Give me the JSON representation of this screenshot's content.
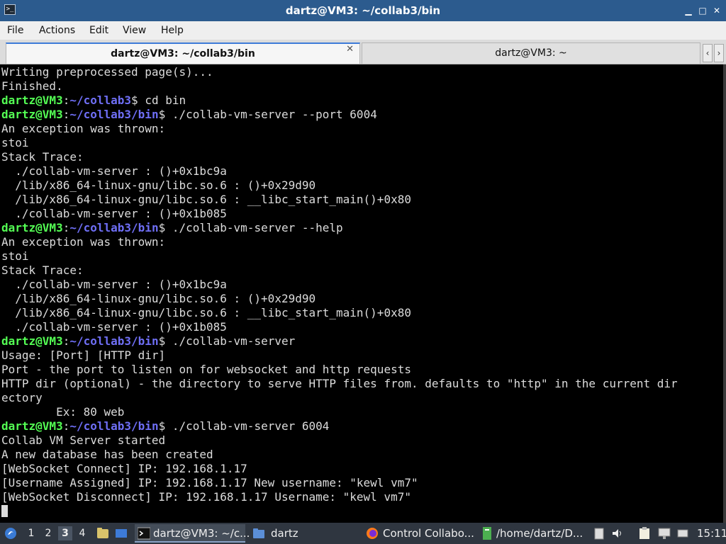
{
  "window": {
    "title": "dartz@VM3: ~/collab3/bin",
    "app_icon_glyph": ">_",
    "minimize_glyph": "▁",
    "maximize_glyph": "□",
    "close_glyph": "✕"
  },
  "menu": [
    "File",
    "Actions",
    "Edit",
    "View",
    "Help"
  ],
  "tabs": [
    {
      "label": "dartz@VM3: ~/collab3/bin",
      "active": true,
      "close_glyph": "✕"
    },
    {
      "label": "dartz@VM3: ~",
      "active": false
    }
  ],
  "tab_nav": {
    "prev": "‹",
    "next": "›"
  },
  "terminal": {
    "lines": [
      {
        "text": "Writing preprocessed page(s)..."
      },
      {
        "text": "Finished."
      },
      {
        "prompt_user": "dartz@VM3",
        "prompt_sep": ":",
        "prompt_dir": "~/collab3",
        "prompt_end": "$ ",
        "cmd": "cd bin"
      },
      {
        "prompt_user": "dartz@VM3",
        "prompt_sep": ":",
        "prompt_dir": "~/collab3/bin",
        "prompt_end": "$ ",
        "cmd": "./collab-vm-server --port 6004"
      },
      {
        "text": "An exception was thrown:"
      },
      {
        "text": "stoi"
      },
      {
        "text": "Stack Trace:"
      },
      {
        "text": "  ./collab-vm-server : ()+0x1bc9a"
      },
      {
        "text": "  /lib/x86_64-linux-gnu/libc.so.6 : ()+0x29d90"
      },
      {
        "text": "  /lib/x86_64-linux-gnu/libc.so.6 : __libc_start_main()+0x80"
      },
      {
        "text": "  ./collab-vm-server : ()+0x1b085"
      },
      {
        "prompt_user": "dartz@VM3",
        "prompt_sep": ":",
        "prompt_dir": "~/collab3/bin",
        "prompt_end": "$ ",
        "cmd": "./collab-vm-server --help"
      },
      {
        "text": "An exception was thrown:"
      },
      {
        "text": "stoi"
      },
      {
        "text": "Stack Trace:"
      },
      {
        "text": "  ./collab-vm-server : ()+0x1bc9a"
      },
      {
        "text": "  /lib/x86_64-linux-gnu/libc.so.6 : ()+0x29d90"
      },
      {
        "text": "  /lib/x86_64-linux-gnu/libc.so.6 : __libc_start_main()+0x80"
      },
      {
        "text": "  ./collab-vm-server : ()+0x1b085"
      },
      {
        "prompt_user": "dartz@VM3",
        "prompt_sep": ":",
        "prompt_dir": "~/collab3/bin",
        "prompt_end": "$ ",
        "cmd": "./collab-vm-server"
      },
      {
        "text": "Usage: [Port] [HTTP dir]"
      },
      {
        "text": "Port - the port to listen on for websocket and http requests"
      },
      {
        "text": "HTTP dir (optional) - the directory to serve HTTP files from. defaults to \"http\" in the current dir"
      },
      {
        "text": "ectory"
      },
      {
        "text": "        Ex: 80 web"
      },
      {
        "prompt_user": "dartz@VM3",
        "prompt_sep": ":",
        "prompt_dir": "~/collab3/bin",
        "prompt_end": "$ ",
        "cmd": "./collab-vm-server 6004"
      },
      {
        "text": "Collab VM Server started"
      },
      {
        "text": "A new database has been created"
      },
      {
        "text": "[WebSocket Connect] IP: 192.168.1.17"
      },
      {
        "text": "[Username Assigned] IP: 192.168.1.17 New username: \"kewl vm7\""
      },
      {
        "text": "[WebSocket Disconnect] IP: 192.168.1.17 Username: \"kewl vm7\""
      },
      {
        "cursor": true
      }
    ]
  },
  "taskbar": {
    "start_icon": "start-menu-icon",
    "workspaces": [
      "1",
      "2",
      "3",
      "4"
    ],
    "active_workspace": "3",
    "tasks": [
      {
        "label": "dartz@VM3: ~/c...",
        "icon": "terminal-icon",
        "active": true
      },
      {
        "label": "dartz",
        "icon": "folder-icon",
        "active": false
      },
      {
        "label": "Control Collabo...",
        "icon": "firefox-icon",
        "active": false
      },
      {
        "label": "/home/dartz/D...",
        "icon": "text-editor-icon",
        "active": false
      }
    ],
    "clock": "15:11"
  },
  "colors": {
    "titlebar": "#2c5b8e",
    "prompt_user": "#54ff54",
    "prompt_dir": "#6f6ff6",
    "terminal_bg": "#000000",
    "terminal_fg": "#dcdcdc",
    "taskbar": "#2f3640"
  }
}
